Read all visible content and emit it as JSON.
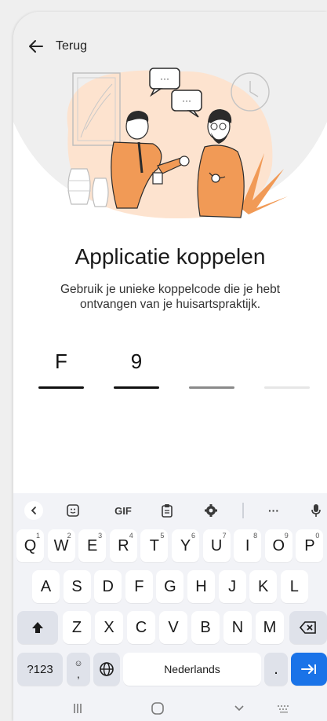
{
  "header": {
    "back_label": "Terug"
  },
  "main": {
    "title": "Applicatie koppelen",
    "subtitle": "Gebruik je unieke koppelcode die je hebt ontvangen van je huisartspraktijk.",
    "code": [
      "F",
      "9",
      "",
      ""
    ]
  },
  "keyboard": {
    "toolbar": {
      "gif_label": "GIF",
      "more_label": "···"
    },
    "row1": [
      {
        "k": "Q",
        "n": "1"
      },
      {
        "k": "W",
        "n": "2"
      },
      {
        "k": "E",
        "n": "3"
      },
      {
        "k": "R",
        "n": "4"
      },
      {
        "k": "T",
        "n": "5"
      },
      {
        "k": "Y",
        "n": "6"
      },
      {
        "k": "U",
        "n": "7"
      },
      {
        "k": "I",
        "n": "8"
      },
      {
        "k": "O",
        "n": "9"
      },
      {
        "k": "P",
        "n": "0"
      }
    ],
    "row2": [
      "A",
      "S",
      "D",
      "F",
      "G",
      "H",
      "J",
      "K",
      "L"
    ],
    "row3": [
      "Z",
      "X",
      "C",
      "V",
      "B",
      "N",
      "M"
    ],
    "symbols_label": "?123",
    "comma_label": ",",
    "space_label": "Nederlands",
    "period_label": ".",
    "colors": {
      "enter": "#1a73e8",
      "peach": "#fde3cf",
      "orange": "#f19a56"
    }
  }
}
